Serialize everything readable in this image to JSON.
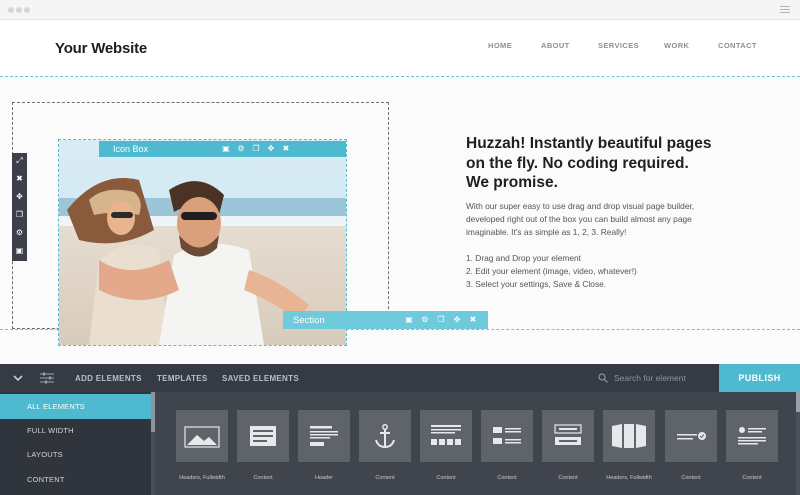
{
  "site": {
    "logo": "Your Website",
    "nav": [
      "HOME",
      "ABOUT",
      "SERVICES",
      "WORK",
      "CONTACT"
    ]
  },
  "editor": {
    "icon_box_label": "Icon Box",
    "section_label": "Section"
  },
  "hero": {
    "headline_lines": [
      "Huzzah! Instantly beautiful pages",
      "on the fly. No coding required.",
      "We promise."
    ],
    "intro_lines": [
      "With our super easy to use drag and drop visual page builder,",
      "developed right out of the box you can build almost any page",
      "imaginable. It's as simple as 1, 2, 3. Really!"
    ],
    "steps": [
      "1. Drag and Drop your element",
      "2. Edit your element (image, video, whatever!)",
      "3. Select your settings, Save & Close."
    ]
  },
  "builder": {
    "tabs": [
      "ADD ELEMENTS",
      "TEMPLATES",
      "SAVED ELEMENTS"
    ],
    "search_placeholder": "Search for element",
    "publish": "PUBLISH",
    "categories": [
      "ALL ELEMENTS",
      "FULL WIDTH",
      "LAYOUTS",
      "CONTENT"
    ],
    "active_category": "ALL ELEMENTS",
    "elements": [
      {
        "label": "Headers, Fullwidth",
        "icon": "image-icon"
      },
      {
        "label": "Content",
        "icon": "text-block-icon"
      },
      {
        "label": "Header",
        "icon": "header-icon"
      },
      {
        "label": "Content",
        "icon": "anchor-icon"
      },
      {
        "label": "Content",
        "icon": "social-icons-icon"
      },
      {
        "label": "Content",
        "icon": "two-column-icon"
      },
      {
        "label": "Content",
        "icon": "buttons-icon"
      },
      {
        "label": "Headers, Fullwidth",
        "icon": "slider-panels-icon"
      },
      {
        "label": "Content",
        "icon": "check-line-icon"
      },
      {
        "label": "Content",
        "icon": "list-icon"
      }
    ]
  },
  "colors": {
    "accent": "#4fb9cf",
    "section_bar": "#6fcadb",
    "builder_dark": "#353a43",
    "tile": "#5f646b"
  }
}
